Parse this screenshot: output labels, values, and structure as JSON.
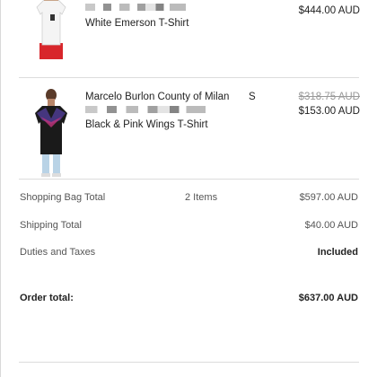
{
  "items": [
    {
      "name_line2": "White Emerson T-Shirt",
      "price": "$444.00 AUD"
    },
    {
      "brand": "Marcelo Burlon County of Milan",
      "size": "S",
      "name_line2": "Black & Pink Wings T-Shirt",
      "price_original": "$318.75 AUD",
      "price": "$153.00 AUD"
    }
  ],
  "summary": {
    "bag_label": "Shopping Bag Total",
    "bag_count": "2 Items",
    "bag_value": "$597.00 AUD",
    "shipping_label": "Shipping Total",
    "shipping_value": "$40.00 AUD",
    "duties_label": "Duties and Taxes",
    "duties_value": "Included",
    "order_label": "Order total:",
    "order_value": "$637.00 AUD"
  },
  "colors": {
    "text": "#222222",
    "muted": "#999999",
    "divider": "#dcdcdc"
  }
}
